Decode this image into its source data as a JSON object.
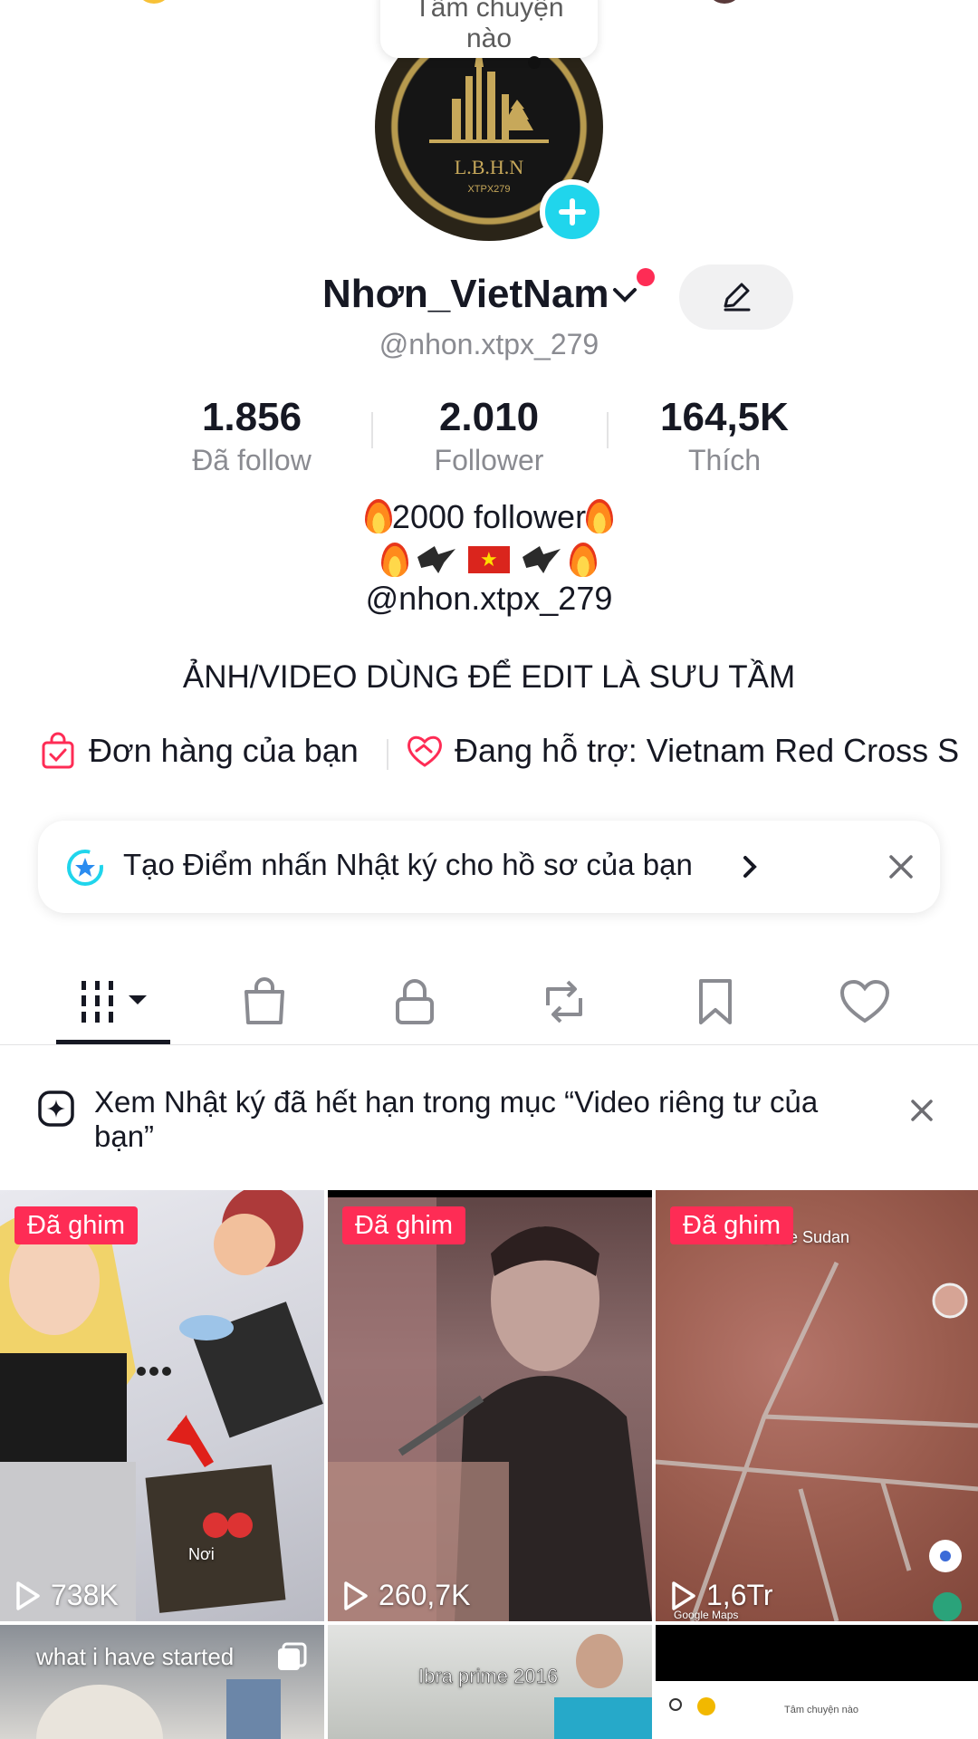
{
  "bubble": {
    "text_top": "Tâm chuyện",
    "text_bottom": "nào"
  },
  "profile": {
    "username": "Nhơn_VietNam",
    "handle": "@nhon.xtpx_279",
    "avatar_text_1": "L.B.H.N",
    "avatar_text_2": "XTPX279"
  },
  "stats": [
    {
      "value": "1.856",
      "label": "Đã follow"
    },
    {
      "value": "2.010",
      "label": "Follower"
    },
    {
      "value": "164,5K",
      "label": "Thích"
    }
  ],
  "bio": {
    "line1": "2000 follower",
    "line3": "@nhon.xtpx_279",
    "line4": "ẢNH/VIDEO DÙNG ĐỂ EDIT LÀ SƯU TẦM"
  },
  "links": {
    "orders": "Đơn hàng của bạn",
    "support": "Đang hỗ trợ: Vietnam Red Cross S"
  },
  "banner": {
    "text": "Tạo Điểm nhấn Nhật ký cho hồ sơ của bạn"
  },
  "tabs": [
    "videos-icon",
    "shop-icon",
    "lock-icon",
    "repost-icon",
    "bookmark-icon",
    "heart-icon"
  ],
  "notice": {
    "text": "Xem Nhật ký đã hết hạn trong mục “Video riêng tư của bạn”"
  },
  "videos": [
    {
      "pinned": "Đã ghim",
      "views": "738K"
    },
    {
      "pinned": "Đã ghim",
      "views": "260,7K"
    },
    {
      "pinned": "Đã ghim",
      "views": "1,6Tr"
    }
  ],
  "video_captions": {
    "v1_note": "Nơi",
    "v3_label": "Free Sudan",
    "v3_google": "Google Maps",
    "v4": "what i have started",
    "v5": "Ibra prime 2016",
    "v6": "Tâm chuyện nào"
  },
  "colors": {
    "accent": "#fe2c55",
    "badge": "#20d5ec",
    "text": "#161823",
    "muted": "#8a8b91"
  }
}
